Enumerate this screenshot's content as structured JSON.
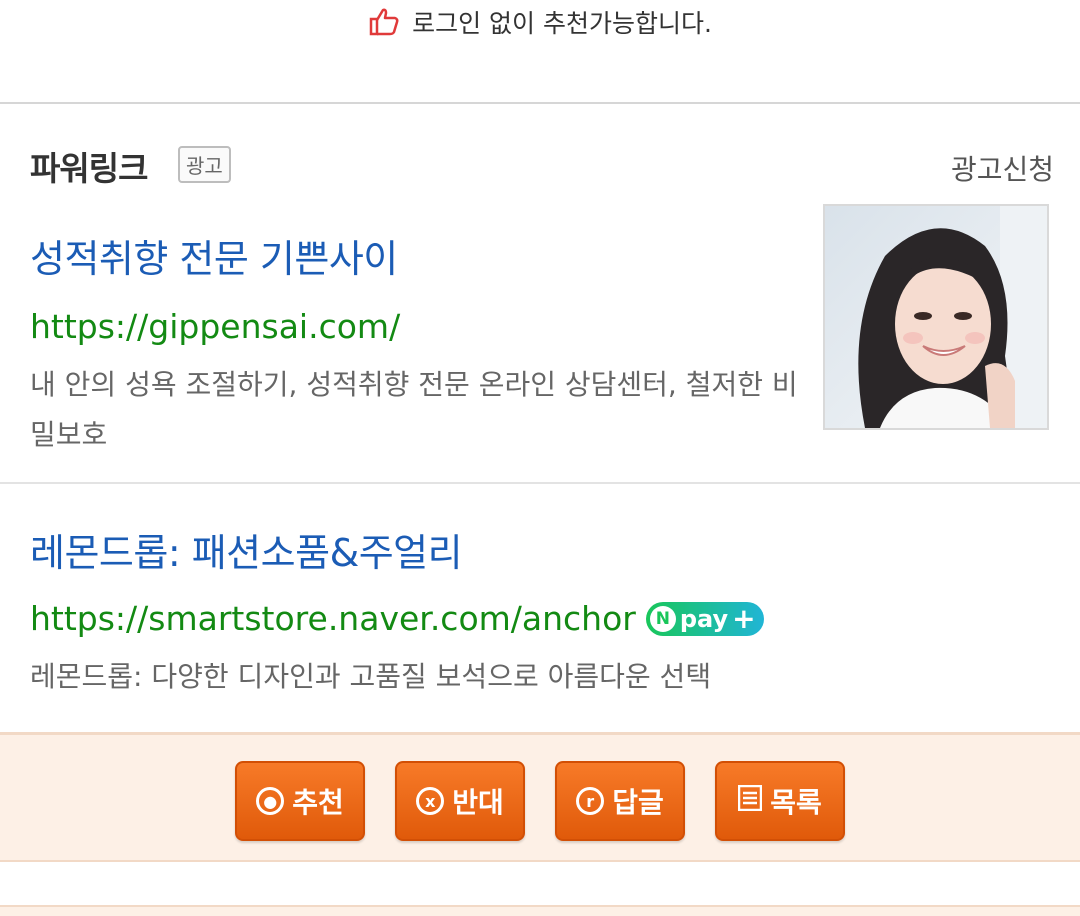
{
  "notice": {
    "text": "로그인 없이 추천가능합니다."
  },
  "powerlink": {
    "title": "파워링크",
    "ad_badge": "광고",
    "apply_link": "광고신청"
  },
  "ads": [
    {
      "title": "성적취향 전문 기쁜사이",
      "url": "https://gippensai.com/",
      "description": "내 안의 성욕 조절하기, 성적취향 전문 온라인 상담센터, 철저한 비밀보호"
    },
    {
      "title": "레몬드롭: 패션소품&주얼리",
      "url": "https://smartstore.naver.com/anchor",
      "description": "레몬드롭: 다양한 디자인과 고품질 보석으로 아름다운 선택",
      "badge": "pay"
    }
  ],
  "buttons": {
    "recommend": "추천",
    "oppose": "반대",
    "reply": "답글",
    "list": "목록"
  },
  "colors": {
    "link_title": "#1b5cb5",
    "link_url": "#138a13",
    "button": "#e8620f"
  }
}
